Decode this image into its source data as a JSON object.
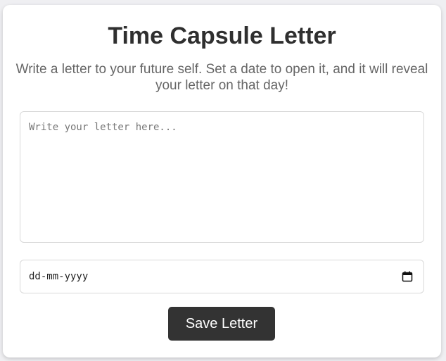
{
  "header": {
    "title": "Time Capsule Letter",
    "subtitle": "Write a letter to your future self. Set a date to open it, and it will reveal your letter on that day!"
  },
  "form": {
    "letter_placeholder": "Write your letter here...",
    "letter_value": "",
    "date_placeholder": "dd-mm-yyyy",
    "date_icon": "calendar-icon",
    "save_label": "Save Letter"
  },
  "colors": {
    "page_background": "#efeff2",
    "card_background": "#ffffff",
    "button_background": "#333333",
    "button_text": "#ffffff",
    "title_text": "#2f2f2f",
    "subtitle_text": "#666666"
  }
}
